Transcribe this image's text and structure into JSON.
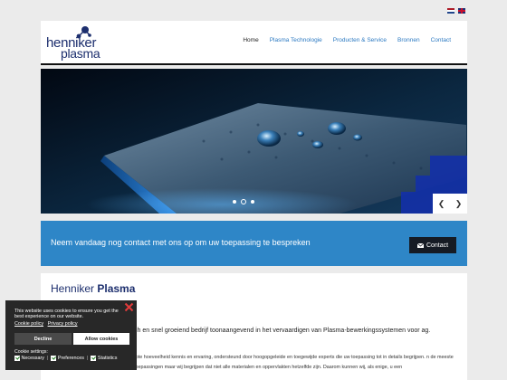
{
  "header": {
    "logo_line1": "henniker",
    "logo_line2": "plasma",
    "nav": [
      "Home",
      "Plasma Technologie",
      "Producten & Service",
      "Bronnen",
      "Contact"
    ],
    "active_nav": "Home"
  },
  "language": {
    "flags": [
      "nl-flag",
      "en-flag"
    ]
  },
  "hero": {
    "slides_total": 3,
    "active_slide": 2,
    "prev_icon": "chevron-left-icon",
    "next_icon": "chevron-right-icon"
  },
  "cta": {
    "text": "Neem vandaag nog contact met ons op om uw toepassing te bespreken",
    "button": "Contact"
  },
  "content": {
    "title_normal": "Henniker",
    "title_bold": "Plasma",
    "paragraph1": "ch en snel groeiend bedrijf toonaangevend in het vervaardigen van Plasma-bewerkingssystemen voor ag.",
    "paragraph2": "rote hoeveelheid kennis en ervaring, ondersteund door hoogopgeleide en toegewijde experts die uw toepassing tot in details begrijpen. n de meeste toepassingen maar wij begrijpen dat niet alle materialen en oppervlakten hetzelfde zijn. Daarom kunnen wij, als enige, u een"
  },
  "cookie": {
    "text": "This website uses cookies to ensure you get the best experience on our website.",
    "link_cookie": "Cookie policy",
    "link_privacy": "Privacy policy",
    "decline": "Decline",
    "allow": "Allow cookies",
    "settings_label": "Cookie settings:",
    "options": [
      "Necessary",
      "Preferences",
      "Statistics"
    ],
    "separator": "|"
  },
  "colors": {
    "accent": "#2e86c7",
    "brand": "#1d2f6e",
    "cta_button": "#161b24",
    "cookie_bg": "#282828"
  }
}
